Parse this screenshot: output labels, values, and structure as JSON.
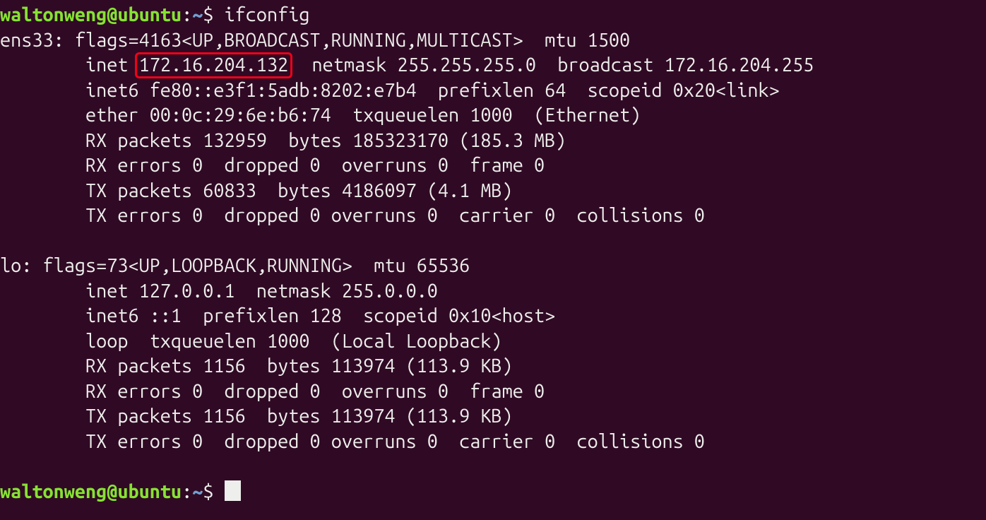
{
  "prompt": {
    "user": "waltonweng",
    "at": "@",
    "host": "ubuntu",
    "colon": ":",
    "path": "~",
    "dollar": "$"
  },
  "command": "ifconfig",
  "ens33": {
    "name": "ens33:",
    "flags_label": "flags=4163<UP,BROADCAST,RUNNING,MULTICAST>  mtu 1500",
    "inet_label": "inet",
    "ip": "172.16.204.132",
    "inet_rest": "  netmask 255.255.255.0  broadcast 172.16.204.255",
    "inet6": "inet6 fe80::e3f1:5adb:8202:e7b4  prefixlen 64  scopeid 0x20<link>",
    "ether": "ether 00:0c:29:6e:b6:74  txqueuelen 1000  (Ethernet)",
    "rx1": "RX packets 132959  bytes 185323170 (185.3 MB)",
    "rx2": "RX errors 0  dropped 0  overruns 0  frame 0",
    "tx1": "TX packets 60833  bytes 4186097 (4.1 MB)",
    "tx2": "TX errors 0  dropped 0 overruns 0  carrier 0  collisions 0"
  },
  "lo": {
    "name": "lo:",
    "flags_label": "flags=73<UP,LOOPBACK,RUNNING>  mtu 65536",
    "inet": "inet 127.0.0.1  netmask 255.0.0.0",
    "inet6": "inet6 ::1  prefixlen 128  scopeid 0x10<host>",
    "loop": "loop  txqueuelen 1000  (Local Loopback)",
    "rx1": "RX packets 1156  bytes 113974 (113.9 KB)",
    "rx2": "RX errors 0  dropped 0  overruns 0  frame 0",
    "tx1": "TX packets 1156  bytes 113974 (113.9 KB)",
    "tx2": "TX errors 0  dropped 0 overruns 0  carrier 0  collisions 0"
  }
}
